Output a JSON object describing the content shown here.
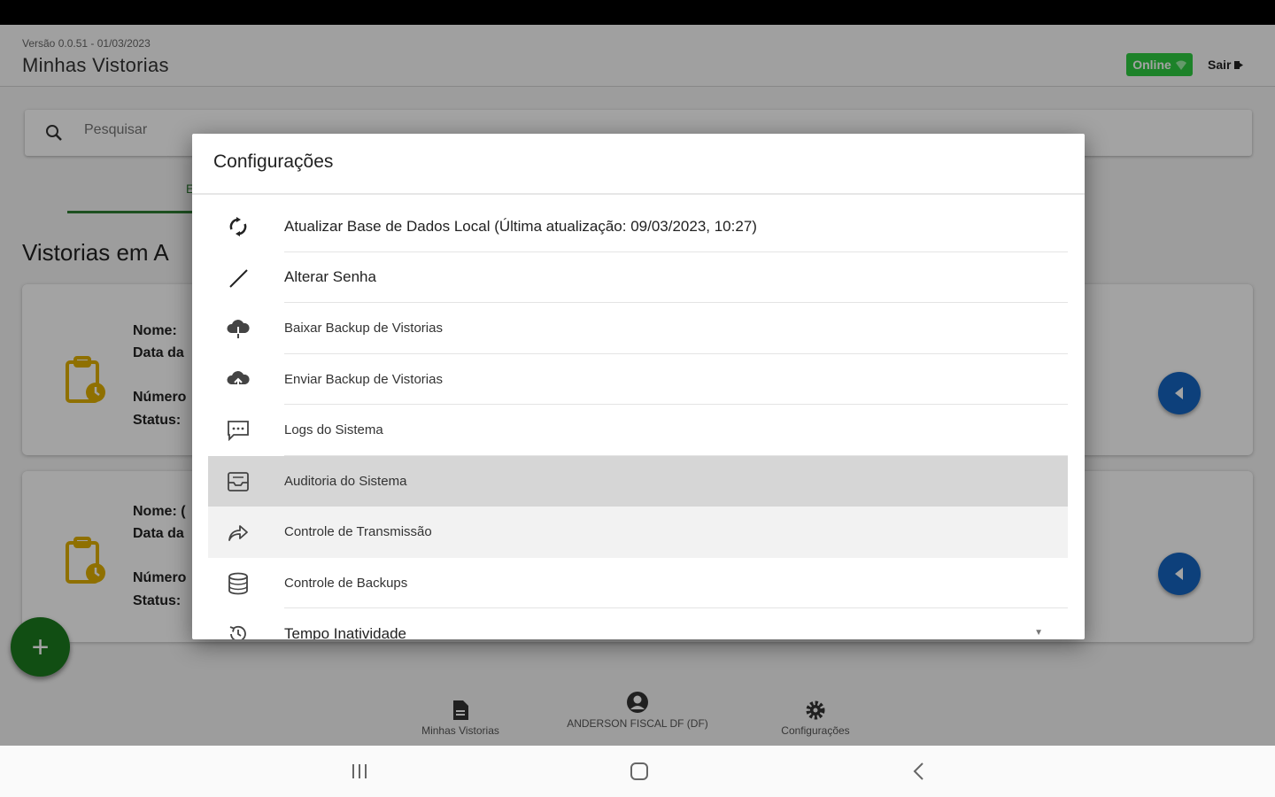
{
  "header": {
    "version": "Versão 0.0.51 - 01/03/2023",
    "title": "Minhas Vistorias",
    "online_label": "Online",
    "logout_label": "Sair"
  },
  "search": {
    "placeholder": "Pesquisar"
  },
  "tabs": {
    "partial_letter": "E"
  },
  "section": {
    "title": "Vistorias em A"
  },
  "cards": [
    {
      "nome": "Nome:",
      "data": "Data da",
      "numero": "Número",
      "status": "Status:"
    },
    {
      "nome": "Nome: (",
      "data": "Data da",
      "numero": "Número",
      "status": "Status:"
    }
  ],
  "fab_label": "+",
  "bottom_nav": [
    {
      "label": "Minhas Vistorias",
      "icon": "document-icon"
    },
    {
      "label": "ANDERSON FISCAL DF (DF)",
      "icon": "user-icon"
    },
    {
      "label": "Configurações",
      "icon": "gear-icon"
    }
  ],
  "dialog": {
    "title": "Configurações",
    "items": [
      {
        "label": "Atualizar Base de Dados Local (Última atualização: 09/03/2023, 10:27)",
        "icon": "sync-icon"
      },
      {
        "label": "Alterar Senha",
        "icon": "pencil-icon"
      },
      {
        "label": "Baixar Backup de Vistorias",
        "icon": "cloud-download-icon"
      },
      {
        "label": "Enviar Backup de Vistorias",
        "icon": "cloud-upload-icon"
      },
      {
        "label": "Logs do Sistema",
        "icon": "chat-icon"
      },
      {
        "label": "Auditoria do Sistema",
        "icon": "inbox-icon"
      },
      {
        "label": "Controle de Transmissão",
        "icon": "share-icon"
      },
      {
        "label": "Controle de Backups",
        "icon": "database-icon"
      },
      {
        "label": "Tempo Inatividade",
        "icon": "history-icon"
      }
    ]
  },
  "colors": {
    "online": "#2ecc40",
    "fab": "#1b7a1f",
    "card_button": "#1565c0",
    "card_icon": "#e0b000",
    "highlight": "#d6d6d6"
  }
}
